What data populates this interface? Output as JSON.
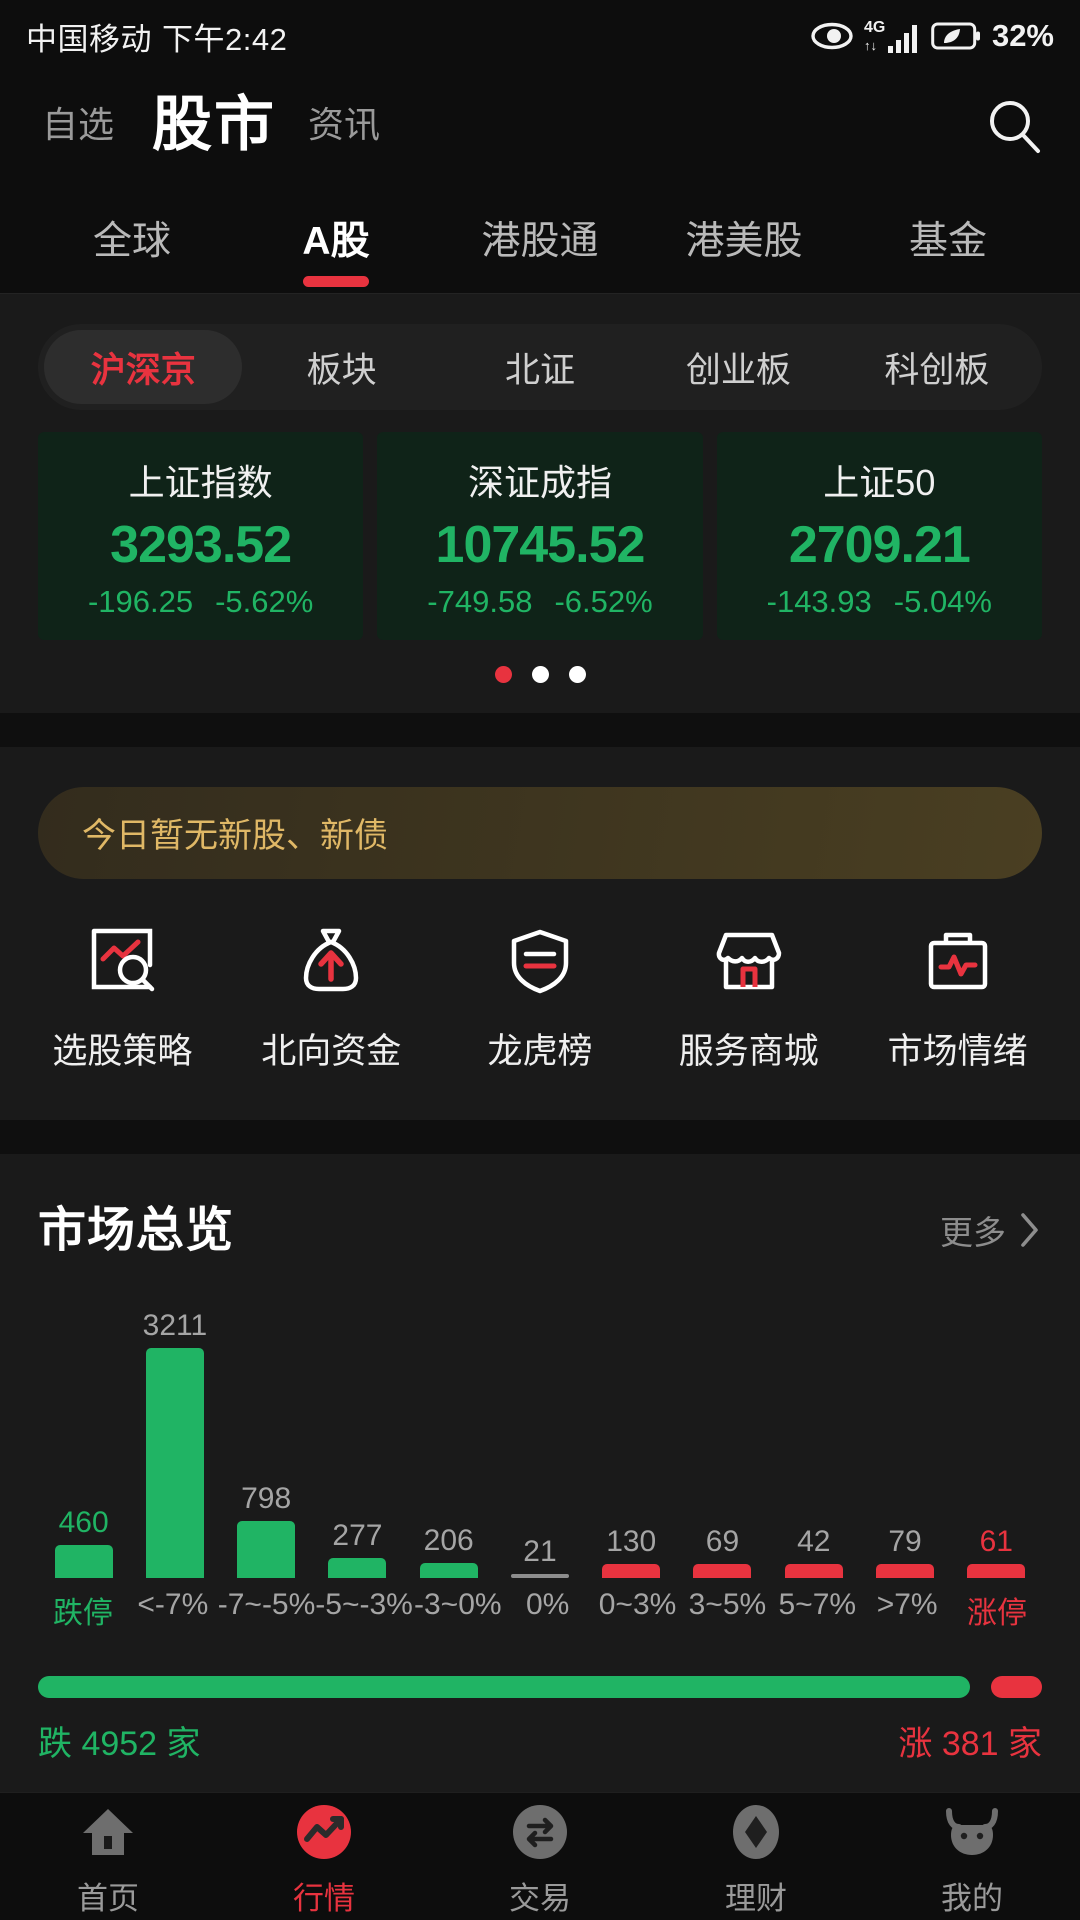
{
  "status_bar": {
    "carrier": "中国移动",
    "time": "下午2:42",
    "network": "4G",
    "battery_pct": "32%",
    "icons": [
      "eye-icon",
      "signal-icon",
      "battery-icon"
    ]
  },
  "header": {
    "tab_watchlist": "自选",
    "tab_market": "股市",
    "tab_news": "资讯",
    "search_icon": "search-icon"
  },
  "category_tabs": [
    {
      "label": "全球",
      "active": false
    },
    {
      "label": "A股",
      "active": true
    },
    {
      "label": "港股通",
      "active": false
    },
    {
      "label": "港美股",
      "active": false
    },
    {
      "label": "基金",
      "active": false
    }
  ],
  "filter_chips": [
    {
      "label": "沪深京",
      "active": true
    },
    {
      "label": "板块",
      "active": false
    },
    {
      "label": "北证",
      "active": false
    },
    {
      "label": "创业板",
      "active": false
    },
    {
      "label": "科创板",
      "active": false
    }
  ],
  "index_cards": [
    {
      "name": "上证指数",
      "value": "3293.52",
      "change": "-196.25",
      "change_pct": "-5.62%"
    },
    {
      "name": "深证成指",
      "value": "10745.52",
      "change": "-749.58",
      "change_pct": "-6.52%"
    },
    {
      "name": "上证50",
      "value": "2709.21",
      "change": "-143.93",
      "change_pct": "-5.04%"
    }
  ],
  "carousel": {
    "total_dots": 3,
    "active_index": 0
  },
  "banner": {
    "text": "今日暂无新股、新债"
  },
  "quick_actions": [
    {
      "label": "选股策略",
      "icon": "chart-search-icon"
    },
    {
      "label": "北向资金",
      "icon": "money-bag-arrow-up-icon"
    },
    {
      "label": "龙虎榜",
      "icon": "shield-rank-icon"
    },
    {
      "label": "服务商城",
      "icon": "storefront-icon"
    },
    {
      "label": "市场情绪",
      "icon": "briefcase-pulse-icon"
    }
  ],
  "market_overview": {
    "title": "市场总览",
    "more_label": "更多",
    "more_icon": "chevron-right-icon",
    "ratio": {
      "down_label": "跌 4952 家",
      "up_label": "涨 381 家",
      "down_count": 4952,
      "up_count": 381
    }
  },
  "chart_data": {
    "type": "bar",
    "title": "市场总览",
    "xlabel": "",
    "ylabel": "",
    "grid": false,
    "ylim": [
      0,
      3211
    ],
    "categories": [
      "跌停",
      "<-7%",
      "-7~-5%",
      "-5~-3%",
      "-3~0%",
      "0%",
      "0~3%",
      "3~5%",
      "5~7%",
      ">7%",
      "涨停"
    ],
    "values": [
      460,
      3211,
      798,
      277,
      206,
      21,
      130,
      69,
      42,
      79,
      61
    ],
    "colors": [
      "#20b464",
      "#20b464",
      "#20b464",
      "#20b464",
      "#20b464",
      "#8d8d8d",
      "#e8333f",
      "#e8333f",
      "#e8333f",
      "#e8333f",
      "#e8333f"
    ],
    "label_colors": [
      "#20b464",
      "#a5a5a5",
      "#a5a5a5",
      "#a5a5a5",
      "#a5a5a5",
      "#a5a5a5",
      "#a5a5a5",
      "#a5a5a5",
      "#a5a5a5",
      "#a5a5a5",
      "#e8333f"
    ],
    "tick_colors": [
      "#20b464",
      "#a5a5a5",
      "#a5a5a5",
      "#a5a5a5",
      "#a5a5a5",
      "#a5a5a5",
      "#a5a5a5",
      "#a5a5a5",
      "#a5a5a5",
      "#a5a5a5",
      "#e8333f"
    ]
  },
  "bottom_nav": [
    {
      "label": "首页",
      "icon": "home-icon",
      "active": false
    },
    {
      "label": "行情",
      "icon": "trend-circle-icon",
      "active": true
    },
    {
      "label": "交易",
      "icon": "exchange-icon",
      "active": false
    },
    {
      "label": "理财",
      "icon": "diamond-icon",
      "active": false
    },
    {
      "label": "我的",
      "icon": "bull-icon",
      "active": false
    }
  ],
  "colors": {
    "up_red": "#e8333f",
    "down_green": "#20b464",
    "gold": "#e0b866",
    "bg": "#1a1a1a"
  }
}
